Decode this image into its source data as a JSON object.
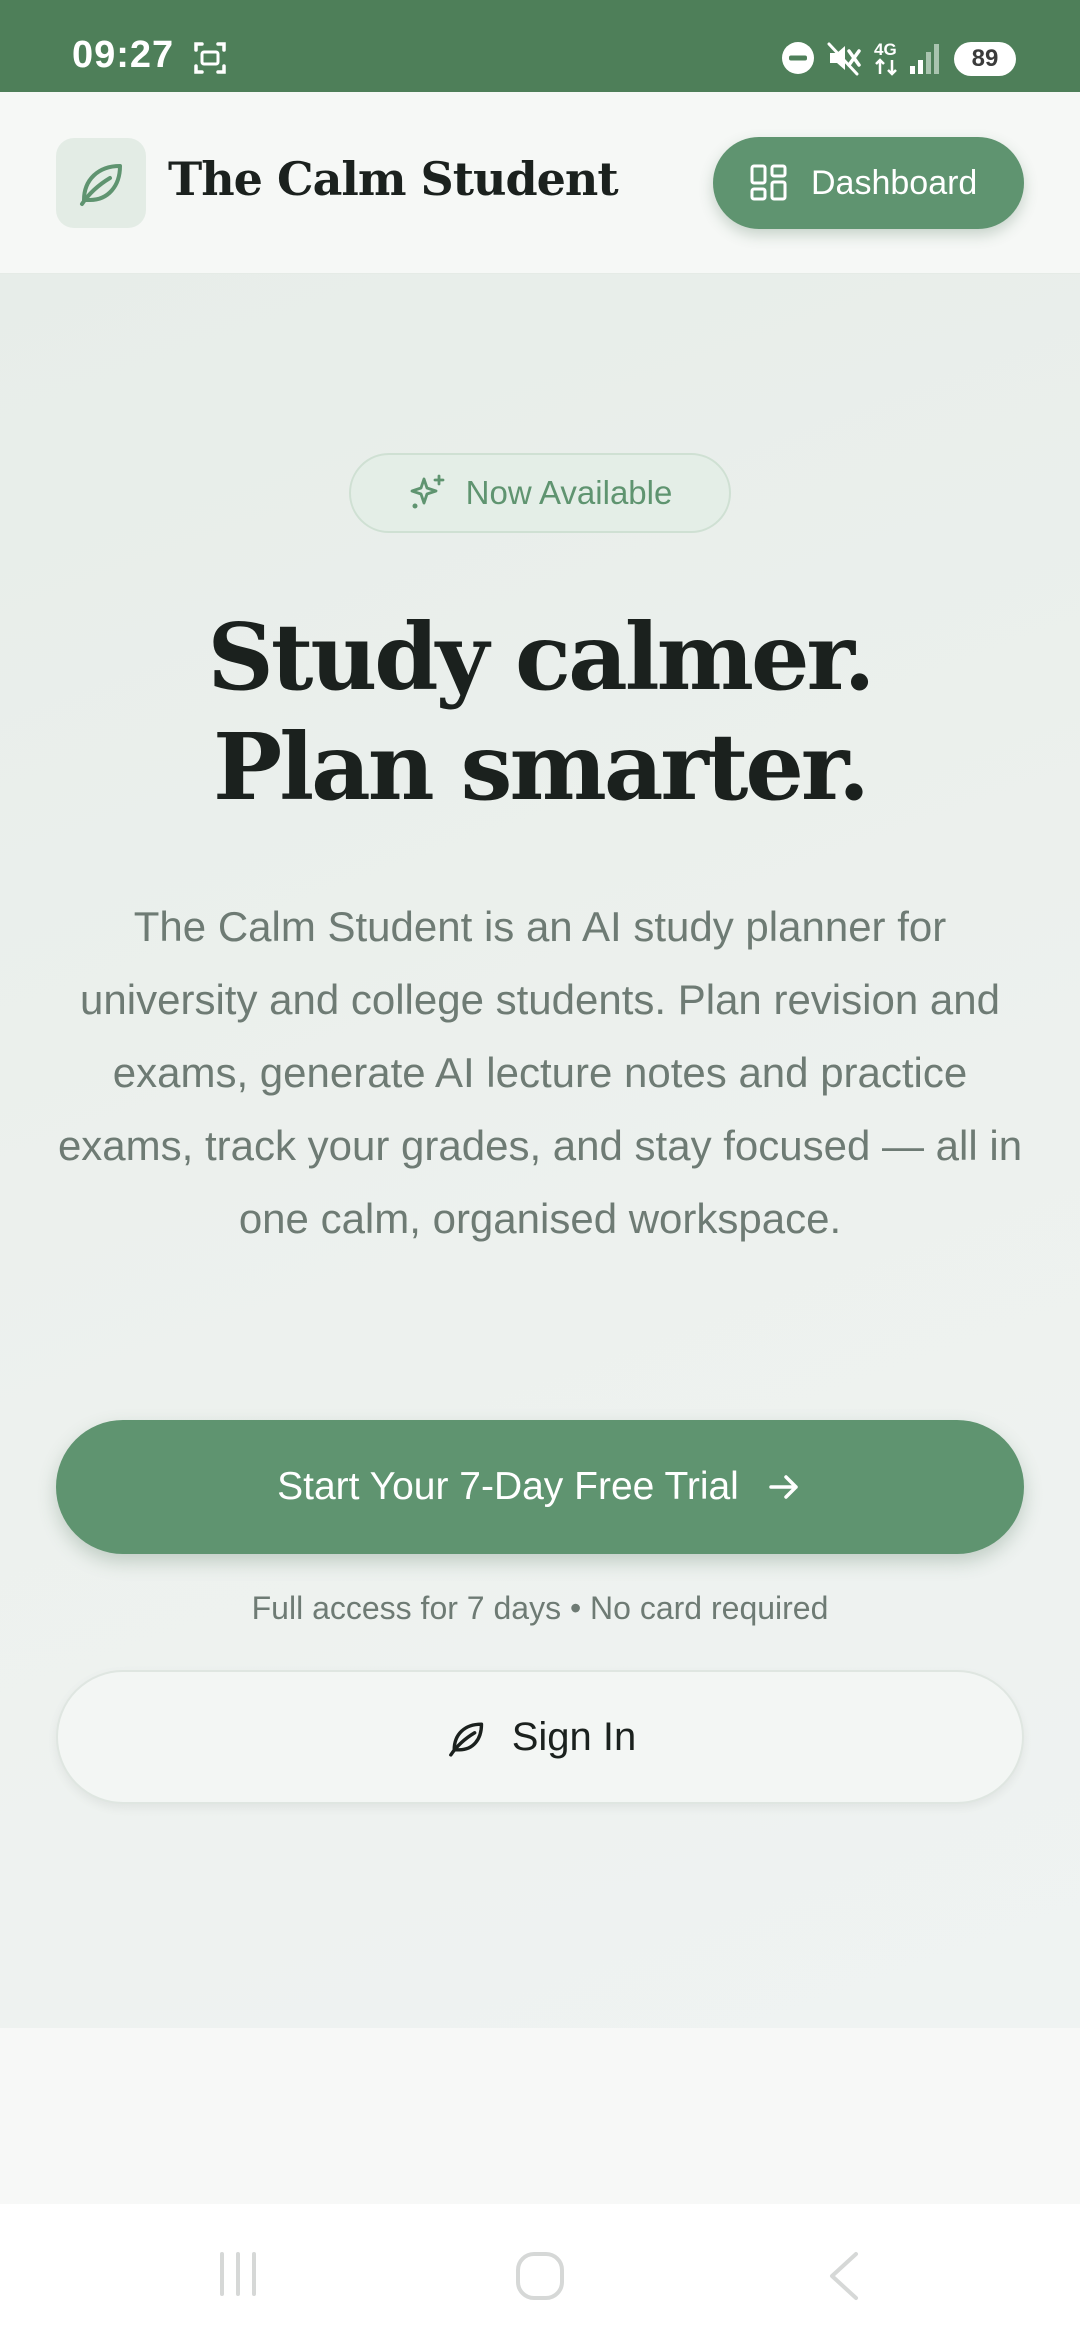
{
  "status_bar": {
    "time": "09:27",
    "battery": "89",
    "network": "4G",
    "icons": [
      "screenshot-icon",
      "do-not-disturb-icon",
      "mute-icon",
      "network-4g-icon",
      "signal-icon",
      "battery-icon"
    ]
  },
  "header": {
    "brand_name": "The Calm Student",
    "logo_icon": "leaf-icon",
    "dashboard_label": "Dashboard",
    "dashboard_icon": "grid-icon"
  },
  "hero": {
    "badge_label": "Now Available",
    "badge_icon": "sparkle-icon",
    "headline_line1": "Study calmer.",
    "headline_line2": "Plan smarter.",
    "description": "The Calm Student is an AI study planner for university and college students. Plan revision and exams, generate AI lecture notes and practice exams, track your grades, and stay focused — all in one calm, organised workspace.",
    "trial_button_label": "Start Your 7-Day Free Trial",
    "trial_note": "Full access for 7 days • No card required",
    "signin_label": "Sign In"
  },
  "nav_bar": {
    "icons": [
      "recent-apps-icon",
      "home-icon",
      "back-icon"
    ]
  },
  "colors": {
    "accent": "#5f9470",
    "status_bar": "#4e7f59",
    "heading": "#1b211e",
    "body_text": "#6e7b74"
  }
}
